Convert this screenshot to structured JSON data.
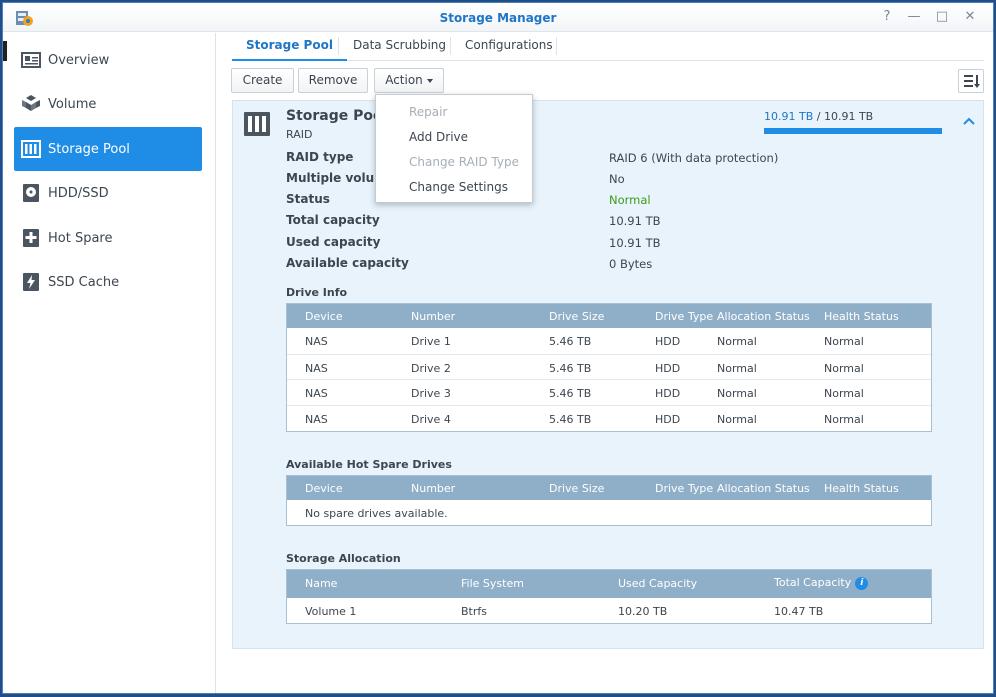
{
  "window": {
    "title": "Storage Manager",
    "help": "?",
    "minimize": "—",
    "maximize": "□",
    "close": "✕"
  },
  "sidebar": {
    "items": [
      {
        "label": "Overview",
        "icon": "overview-icon"
      },
      {
        "label": "Volume",
        "icon": "volume-icon"
      },
      {
        "label": "Storage Pool",
        "icon": "storage-pool-icon",
        "active": true
      },
      {
        "label": "HDD/SSD",
        "icon": "hdd-icon"
      },
      {
        "label": "Hot Spare",
        "icon": "hot-spare-icon"
      },
      {
        "label": "SSD Cache",
        "icon": "ssd-cache-icon"
      }
    ]
  },
  "tabs": [
    {
      "label": "Storage Pool",
      "active": true
    },
    {
      "label": "Data Scrubbing"
    },
    {
      "label": "Configurations"
    }
  ],
  "toolbar": {
    "create": "Create",
    "remove": "Remove",
    "action": "Action"
  },
  "action_menu": {
    "items": [
      {
        "label": "Repair",
        "disabled": true
      },
      {
        "label": "Add Drive",
        "disabled": false
      },
      {
        "label": "Change RAID Type",
        "disabled": true
      },
      {
        "label": "Change Settings",
        "disabled": false
      }
    ]
  },
  "pool": {
    "title": "Storage Pool",
    "subtitle": "RAID",
    "used_capacity": "10.91 TB",
    "separator": " / ",
    "total_capacity": "10.91 TB",
    "usage_fraction": 1.0,
    "properties": [
      {
        "label": "RAID type",
        "value": "RAID 6 (With data protection)"
      },
      {
        "label": "Multiple volume",
        "value": "No"
      },
      {
        "label": "Status",
        "value": "Normal"
      },
      {
        "label": "Total capacity",
        "value": "10.91 TB"
      },
      {
        "label": "Used capacity",
        "value": "10.91 TB"
      },
      {
        "label": "Available capacity",
        "value": "0 Bytes"
      }
    ]
  },
  "drive_info": {
    "title": "Drive Info",
    "headers": [
      "Device",
      "Number",
      "Drive Size",
      "Drive Type",
      "Allocation Status",
      "Health Status"
    ],
    "rows": [
      [
        "NAS",
        "Drive 1",
        "5.46 TB",
        "HDD",
        "Normal",
        "Normal"
      ],
      [
        "NAS",
        "Drive 2",
        "5.46 TB",
        "HDD",
        "Normal",
        "Normal"
      ],
      [
        "NAS",
        "Drive 3",
        "5.46 TB",
        "HDD",
        "Normal",
        "Normal"
      ],
      [
        "NAS",
        "Drive 4",
        "5.46 TB",
        "HDD",
        "Normal",
        "Normal"
      ]
    ]
  },
  "hot_spare": {
    "title": "Available Hot Spare Drives",
    "headers": [
      "Device",
      "Number",
      "Drive Size",
      "Drive Type",
      "Allocation Status",
      "Health Status"
    ],
    "empty": "No spare drives available."
  },
  "allocation": {
    "title": "Storage Allocation",
    "headers": [
      "Name",
      "File System",
      "Used Capacity",
      "Total Capacity"
    ],
    "info": "i",
    "rows": [
      [
        "Volume 1",
        "Btrfs",
        "10.20 TB",
        "10.47 TB"
      ]
    ]
  }
}
